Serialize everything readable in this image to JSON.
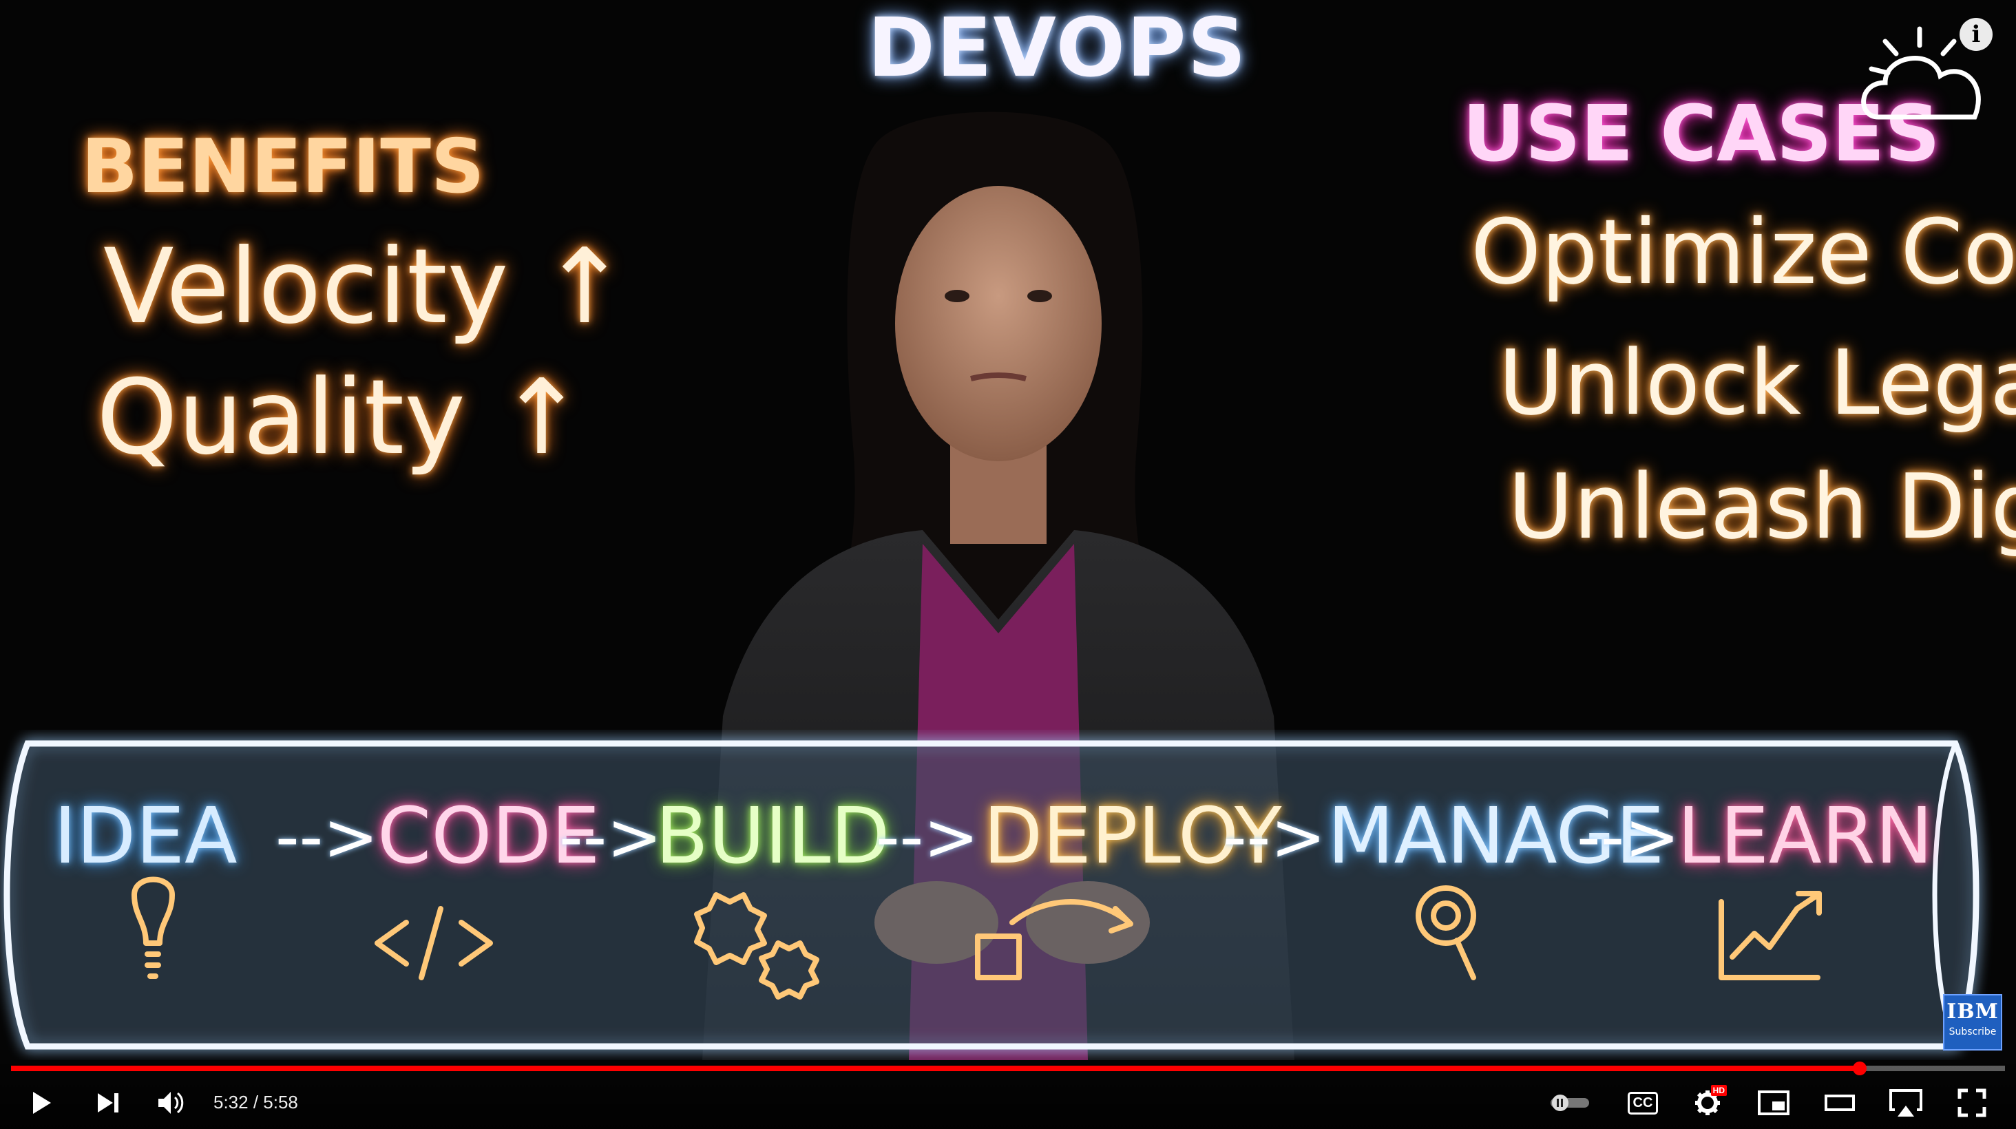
{
  "video": {
    "title": "DEVOPS",
    "benefits": {
      "heading": "BENEFITS",
      "items": [
        "Velocity ↑",
        "Quality ↑"
      ]
    },
    "use_cases": {
      "heading": "USE CASES",
      "items": [
        "Optimize Core",
        "Unlock Legacy",
        "Unleash Digital"
      ]
    },
    "pipeline": {
      "stages": [
        "IDEA",
        "CODE",
        "BUILD",
        "DEPLOY",
        "MANAGE",
        "LEARN"
      ],
      "arrow": "-->"
    },
    "branding": {
      "badge_brand": "IBM",
      "badge_sub": "Subscribe",
      "info_glyph": "i"
    }
  },
  "player": {
    "time_current": "5:32",
    "time_separator": " / ",
    "time_total": "5:58",
    "progress_fraction": 0.927,
    "accent_color": "#ff0000",
    "icons": [
      "play-icon",
      "next-icon",
      "volume-icon",
      "autoplay-toggle-icon",
      "captions-icon",
      "settings-icon",
      "miniplayer-icon",
      "theater-icon",
      "airplay-icon",
      "fullscreen-icon"
    ],
    "settings_badge": "HD",
    "captions_label": "CC"
  }
}
